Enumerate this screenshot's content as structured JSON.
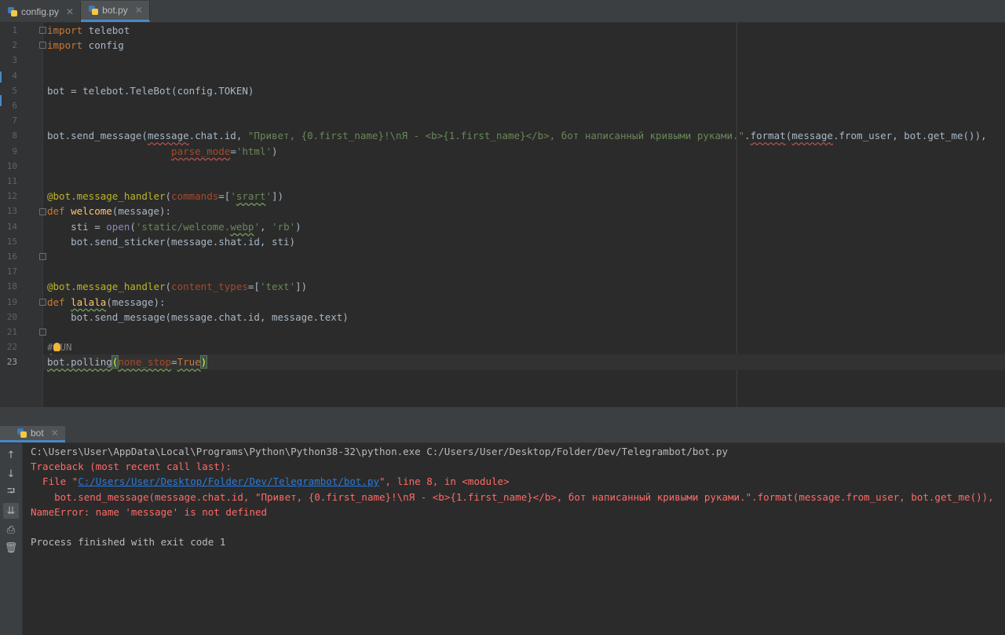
{
  "editor_tabs": [
    {
      "label": "config.py",
      "active": false
    },
    {
      "label": "bot.py",
      "active": true
    }
  ],
  "line_numbers": [
    "1",
    "2",
    "3",
    "4",
    "5",
    "6",
    "7",
    "8",
    "9",
    "10",
    "11",
    "12",
    "13",
    "14",
    "15",
    "16",
    "17",
    "18",
    "19",
    "20",
    "21",
    "22",
    "23"
  ],
  "code": {
    "l1": {
      "kw": "import",
      "rest": " telebot"
    },
    "l2": {
      "kw": "import",
      "rest": " config"
    },
    "l5": "bot = telebot.TeleBot(config.TOKEN)",
    "l8": {
      "a": "bot.send_message(",
      "b": "message",
      "c": ".chat.id, ",
      "str": "\"Привет, {0.first_name}!\\nЯ - <b>{1.first_name}</b>, бот написанный кривыми руками.\"",
      "d": ".",
      "e": "format",
      "f": "(",
      "g": "message",
      "h": ".from_user, bot.get_me()),"
    },
    "l9": {
      "indent": "                     ",
      "param": "parse_mode",
      "eq": "=",
      "str": "'html'",
      "close": ")"
    },
    "l12": {
      "dec": "@bot.message_handler",
      "open": "(",
      "param": "commands",
      "eq": "=[",
      "q1": "'",
      "word": "srart",
      "q2": "'",
      "close": "])"
    },
    "l13": {
      "kw": "def",
      "sp": " ",
      "fn": "welcome",
      "rest": "(message):"
    },
    "l14": {
      "indent": "    ",
      "a": "sti = ",
      "bi": "open",
      "b": "(",
      "s1": "'static/welcome.",
      "s2": "webp",
      "s3": "'",
      "c": ", ",
      "s4": "'rb'",
      "d": ")"
    },
    "l15": "    bot.send_sticker(message.shat.id, sti)",
    "l18": {
      "dec": "@bot.message_handler",
      "open": "(",
      "param": "content_types",
      "eq": "=[",
      "str": "'text'",
      "close": "])"
    },
    "l19": {
      "kw": "def",
      "sp": " ",
      "fn": "lalala",
      "rest": "(message):"
    },
    "l20": "    bot.send_message(message.chat.id, message.text)",
    "l22": {
      "a": "#",
      "b": "UN"
    },
    "l23": {
      "a": "bot.polling",
      "b": "(",
      "param": "none_stop",
      "eq": "=",
      "val": "True",
      "c": ")"
    }
  },
  "run_tab": {
    "label": "bot"
  },
  "toolbar_icons": [
    "arrow-up-icon",
    "arrow-down-icon",
    "soft-wrap-icon",
    "scroll-to-end-icon",
    "print-icon",
    "trash-icon"
  ],
  "console": {
    "cmd": "C:\\Users\\User\\AppData\\Local\\Programs\\Python\\Python38-32\\python.exe C:/Users/User/Desktop/Folder/Dev/Telegrambot/bot.py",
    "tb": "Traceback (most recent call last):",
    "file_pre": "  File \"",
    "file_link": "C:/Users/User/Desktop/Folder/Dev/Telegrambot/bot.py",
    "file_post": "\", line 8, in <module>",
    "src": "    bot.send_message(message.chat.id, \"Привет, {0.first_name}!\\nЯ - <b>{1.first_name}</b>, бот написанный кривыми руками.\".format(message.from_user, bot.get_me()),",
    "err": "NameError: name 'message' is not defined",
    "exit": "Process finished with exit code 1"
  },
  "colors": {
    "keyword": "#cc7832",
    "string": "#6a8759",
    "decorator": "#bbb529",
    "function": "#ffc66d",
    "error": "#ff6b68",
    "link": "#287bde"
  }
}
